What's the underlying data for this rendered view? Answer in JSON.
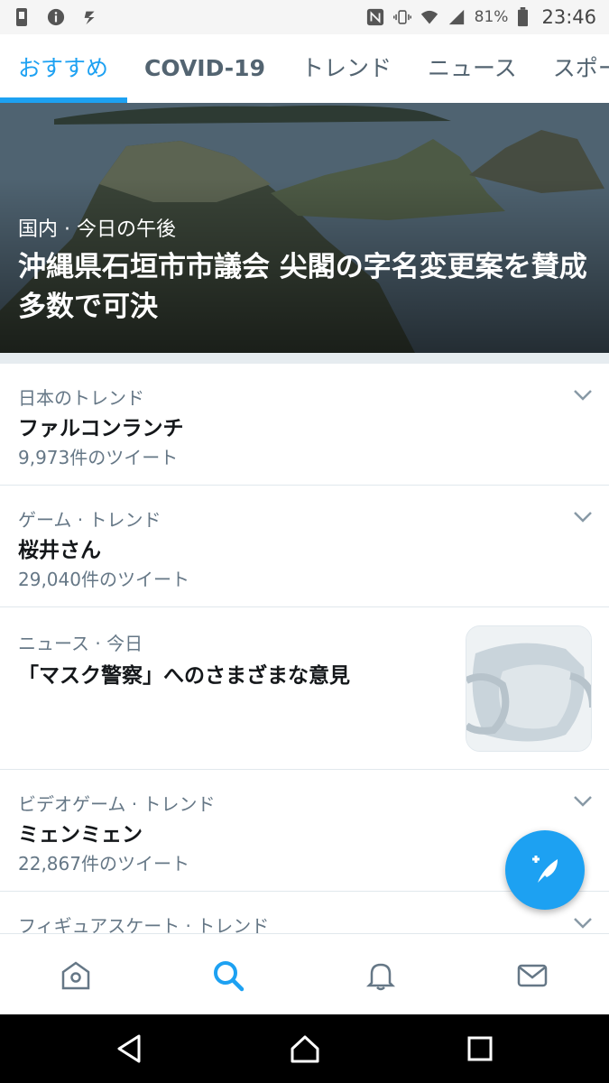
{
  "status_bar": {
    "battery": "81%",
    "time": "23:46",
    "icons": [
      "phone-icon",
      "info-icon",
      "notification-icon",
      "nfc-icon",
      "vibrate-icon",
      "wifi-icon",
      "signal-icon",
      "battery-icon"
    ]
  },
  "tabs": [
    {
      "label": "おすすめ"
    },
    {
      "label": "COVID-19"
    },
    {
      "label": "トレンド"
    },
    {
      "label": "ニュース"
    },
    {
      "label": "スポーツ"
    }
  ],
  "hero": {
    "meta": "国内 · 今日の午後",
    "headline": "沖縄県石垣市市議会 尖閣の字名変更案を賛成多数で可決"
  },
  "trends": [
    {
      "context": "日本のトレンド",
      "title": "ファルコンランチ",
      "count": "9,973件のツイート"
    },
    {
      "context": "ゲーム · トレンド",
      "title": "桜井さん",
      "count": "29,040件のツイート"
    },
    {
      "context": "ニュース · 今日",
      "title": "「マスク警察」へのさまざまな意見"
    },
    {
      "context": "ビデオゲーム · トレンド",
      "title": "ミェンミェン",
      "count": "22,867件のツイート"
    },
    {
      "context": "フィギュアスケート · トレンド"
    }
  ],
  "colors": {
    "accent": "#1da1f2",
    "secondary_text": "#657786"
  },
  "bottom_nav": [
    "home-icon",
    "search-icon",
    "notifications-icon",
    "messages-icon"
  ],
  "system_nav": [
    "back-icon",
    "home-icon",
    "recents-icon"
  ]
}
